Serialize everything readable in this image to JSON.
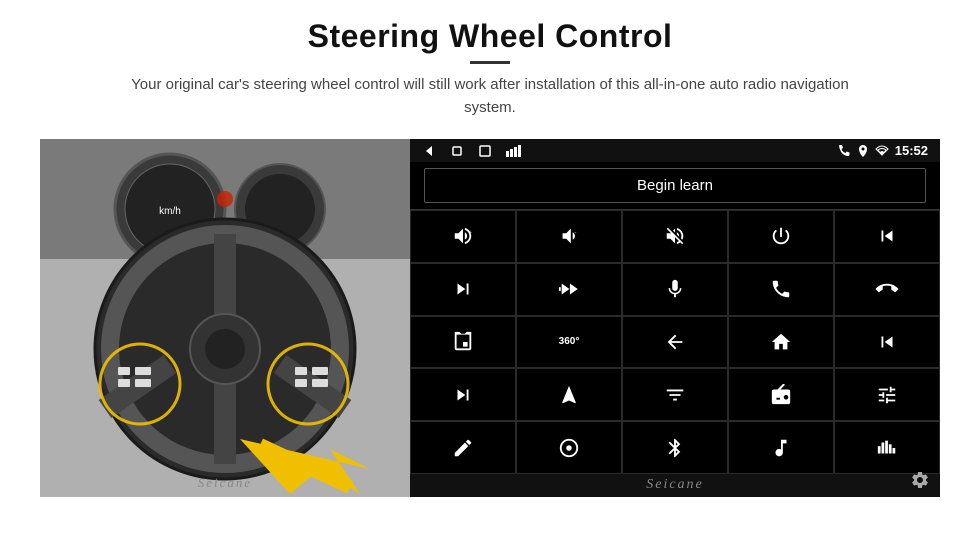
{
  "page": {
    "title": "Steering Wheel Control",
    "subtitle": "Your original car's steering wheel control will still work after installation of this all-in-one auto radio navigation system.",
    "divider": true
  },
  "panel": {
    "begin_learn_label": "Begin learn",
    "status_time": "15:52",
    "seicane_label": "Seicane"
  },
  "grid_icons": [
    {
      "row": 1,
      "col": 1,
      "symbol": "vol_up",
      "unicode": "🔊+"
    },
    {
      "row": 1,
      "col": 2,
      "symbol": "vol_down",
      "unicode": "🔉−"
    },
    {
      "row": 1,
      "col": 3,
      "symbol": "mute",
      "unicode": "🔇"
    },
    {
      "row": 1,
      "col": 4,
      "symbol": "power",
      "unicode": "⏻"
    },
    {
      "row": 1,
      "col": 5,
      "symbol": "prev_track",
      "unicode": "⏮"
    },
    {
      "row": 2,
      "col": 1,
      "symbol": "next",
      "unicode": "⏭"
    },
    {
      "row": 2,
      "col": 2,
      "symbol": "fast_fwd",
      "unicode": "⏩"
    },
    {
      "row": 2,
      "col": 3,
      "symbol": "mic",
      "unicode": "🎤"
    },
    {
      "row": 2,
      "col": 4,
      "symbol": "phone",
      "unicode": "📞"
    },
    {
      "row": 2,
      "col": 5,
      "symbol": "hang_up",
      "unicode": "📵"
    },
    {
      "row": 3,
      "col": 1,
      "symbol": "cam",
      "unicode": "📷"
    },
    {
      "row": 3,
      "col": 2,
      "symbol": "360",
      "unicode": "360°"
    },
    {
      "row": 3,
      "col": 3,
      "symbol": "back",
      "unicode": "↩"
    },
    {
      "row": 3,
      "col": 4,
      "symbol": "home",
      "unicode": "⌂"
    },
    {
      "row": 3,
      "col": 5,
      "symbol": "skip_back",
      "unicode": "⏮"
    },
    {
      "row": 4,
      "col": 1,
      "symbol": "skip_fwd",
      "unicode": "⏭"
    },
    {
      "row": 4,
      "col": 2,
      "symbol": "nav",
      "unicode": "▲"
    },
    {
      "row": 4,
      "col": 3,
      "symbol": "eq",
      "unicode": "⇌"
    },
    {
      "row": 4,
      "col": 4,
      "symbol": "radio",
      "unicode": "📻"
    },
    {
      "row": 4,
      "col": 5,
      "symbol": "adjust",
      "unicode": "⚙"
    },
    {
      "row": 5,
      "col": 1,
      "symbol": "pen",
      "unicode": "✏"
    },
    {
      "row": 5,
      "col": 2,
      "symbol": "dial",
      "unicode": "⊙"
    },
    {
      "row": 5,
      "col": 3,
      "symbol": "bt",
      "unicode": "⚡"
    },
    {
      "row": 5,
      "col": 4,
      "symbol": "music",
      "unicode": "🎵"
    },
    {
      "row": 5,
      "col": 5,
      "symbol": "bars",
      "unicode": "|||"
    }
  ]
}
